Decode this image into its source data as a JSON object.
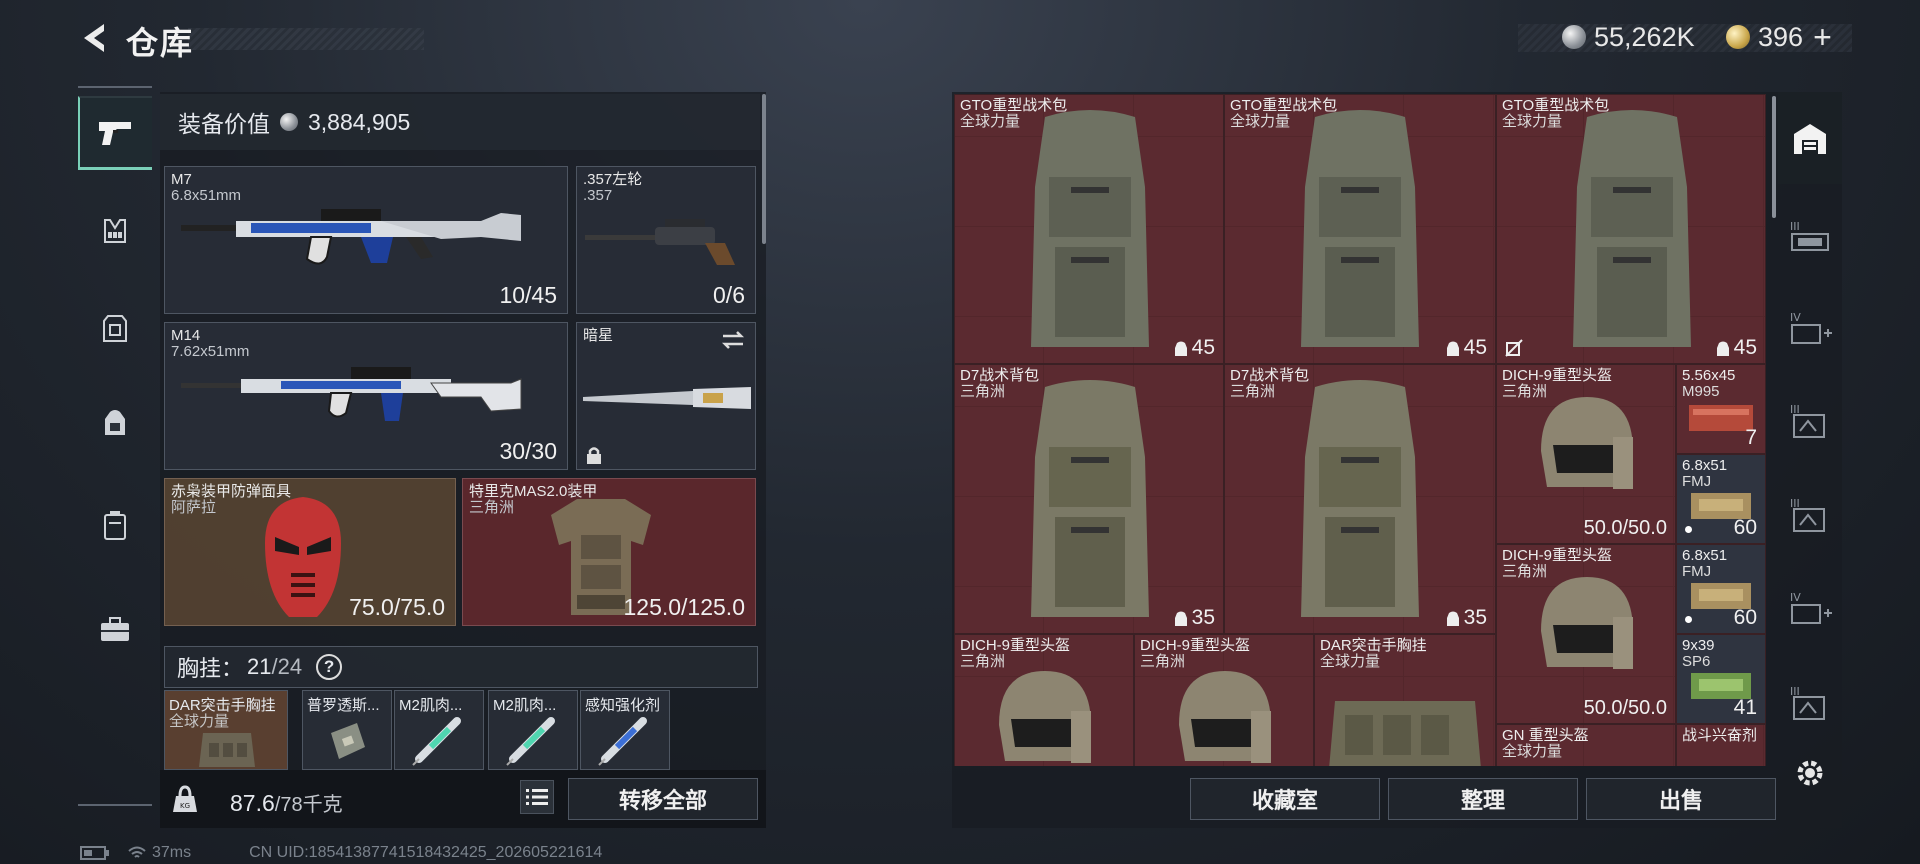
{
  "header": {
    "title": "仓库",
    "silver_amount": "55,262K",
    "gold_amount": "396",
    "add_label": "+"
  },
  "loadout": {
    "equip_value_label": "装备价值",
    "equip_value": "3,884,905",
    "slots": {
      "primary1": {
        "name": "M7",
        "caliber": "6.8x51mm",
        "ammo": "10/45"
      },
      "secondary": {
        "name": ".357左轮",
        "caliber": ".357",
        "ammo": "0/6"
      },
      "primary2": {
        "name": "M14",
        "caliber": "7.62x51mm",
        "ammo": "30/30"
      },
      "melee": {
        "name": "暗星"
      },
      "helmet": {
        "name": "赤枭装甲防弹面具",
        "origin": "阿萨拉",
        "durability": "75.0/75.0"
      },
      "armor": {
        "name": "特里克MAS2.0装甲",
        "origin": "三角洲",
        "durability": "125.0/125.0"
      }
    },
    "chest_rig_label": "胸挂：",
    "chest_rig_used": "21",
    "chest_rig_total": "/24",
    "help_label": "?",
    "chest_items": [
      {
        "name": "DAR突击手胸挂",
        "sub": "全球力量"
      },
      {
        "name": "普罗透斯..."
      },
      {
        "name": "M2肌肉..."
      },
      {
        "name": "M2肌肉..."
      },
      {
        "name": "感知强化剂"
      }
    ],
    "weight": "87.6",
    "weight_max": "/78千克",
    "transfer_all": "转移全部"
  },
  "storage": {
    "items": [
      {
        "name": "GTO重型战术包",
        "sub": "全球力量",
        "count": "45"
      },
      {
        "name": "GTO重型战术包",
        "sub": "全球力量",
        "count": "45"
      },
      {
        "name": "GTO重型战术包",
        "sub": "全球力量",
        "count": "45"
      },
      {
        "name": "D7战术背包",
        "sub": "三角洲",
        "count": "35"
      },
      {
        "name": "D7战术背包",
        "sub": "三角洲",
        "count": "35"
      },
      {
        "name": "DICH-9重型头盔",
        "sub": "三角洲",
        "count": "50.0/50.0"
      },
      {
        "name": "5.56x45",
        "sub": "M995",
        "count": "7"
      },
      {
        "name": "6.8x51",
        "sub": "FMJ",
        "count": "60"
      },
      {
        "name": "DICH-9重型头盔",
        "sub": "三角洲",
        "count": "50.0/50.0"
      },
      {
        "name": "6.8x51",
        "sub": "FMJ",
        "count": "60"
      },
      {
        "name": "DICH-9重型头盔",
        "sub": "三角洲"
      },
      {
        "name": "DICH-9重型头盔",
        "sub": "三角洲"
      },
      {
        "name": "DAR突击手胸挂",
        "sub": "全球力量"
      },
      {
        "name": "9x39",
        "sub": "SP6",
        "count": "41"
      },
      {
        "name": "GN 重型头盔",
        "sub": "全球力量"
      },
      {
        "name": "战斗兴奋剂"
      }
    ],
    "collection_room": "收藏室",
    "organize": "整理",
    "sell": "出售"
  },
  "status_bar": {
    "ping": "37ms",
    "uid": "CN UID:18541387741518432425_202605221614"
  },
  "colors": {
    "accent": "#7ad0b8",
    "item_red": "#5b2a30",
    "panel": "#1c2128"
  }
}
